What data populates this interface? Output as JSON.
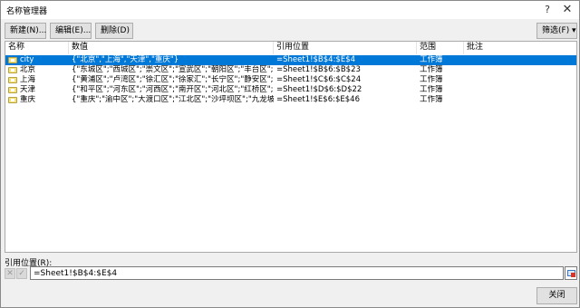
{
  "dialog": {
    "title": "名称管理器",
    "help_label": "?",
    "close_label": "✕"
  },
  "toolbar": {
    "new_label": "新建(N)...",
    "edit_label": "编辑(E)...",
    "delete_label": "删除(D)",
    "filter_label": "筛选(F) ▾"
  },
  "table": {
    "columns": [
      "名称",
      "数值",
      "引用位置",
      "范围",
      "批注"
    ],
    "rows": [
      {
        "name": "city",
        "value": "{\"北京\",\"上海\",\"天津\",\"重庆\"}",
        "ref": "=Sheet1!$B$4:$E$4",
        "scope": "工作簿",
        "note": "",
        "selected": true
      },
      {
        "name": "北京",
        "value": "{\"东城区\";\"西城区\";\"崇文区\";\"宣武区\";\"朝阳区\";\"丰台区\";\"...",
        "ref": "=Sheet1!$B$6:$B$23",
        "scope": "工作簿",
        "note": "",
        "selected": false
      },
      {
        "name": "上海",
        "value": "{\"黄浦区\";\"卢湾区\";\"徐汇区\";\"徐家汇\";\"长宁区\";\"静安区\";\"...",
        "ref": "=Sheet1!$C$6:$C$24",
        "scope": "工作簿",
        "note": "",
        "selected": false
      },
      {
        "name": "天津",
        "value": "{\"和平区\";\"河东区\";\"河西区\";\"南开区\";\"河北区\";\"红桥区\";\"...",
        "ref": "=Sheet1!$D$6:$D$22",
        "scope": "工作簿",
        "note": "",
        "selected": false
      },
      {
        "name": "重庆",
        "value": "{\"重庆\";\"渝中区\";\"大渡口区\";\"江北区\";\"沙坪坝区\";\"九龙坡...",
        "ref": "=Sheet1!$E$6:$E$46",
        "scope": "工作簿",
        "note": "",
        "selected": false
      }
    ]
  },
  "reference": {
    "label": "引用位置(R):",
    "value": "=Sheet1!$B$4:$E$4",
    "cancel_glyph": "✕",
    "confirm_glyph": "✓"
  },
  "footer": {
    "close_label": "关闭"
  }
}
